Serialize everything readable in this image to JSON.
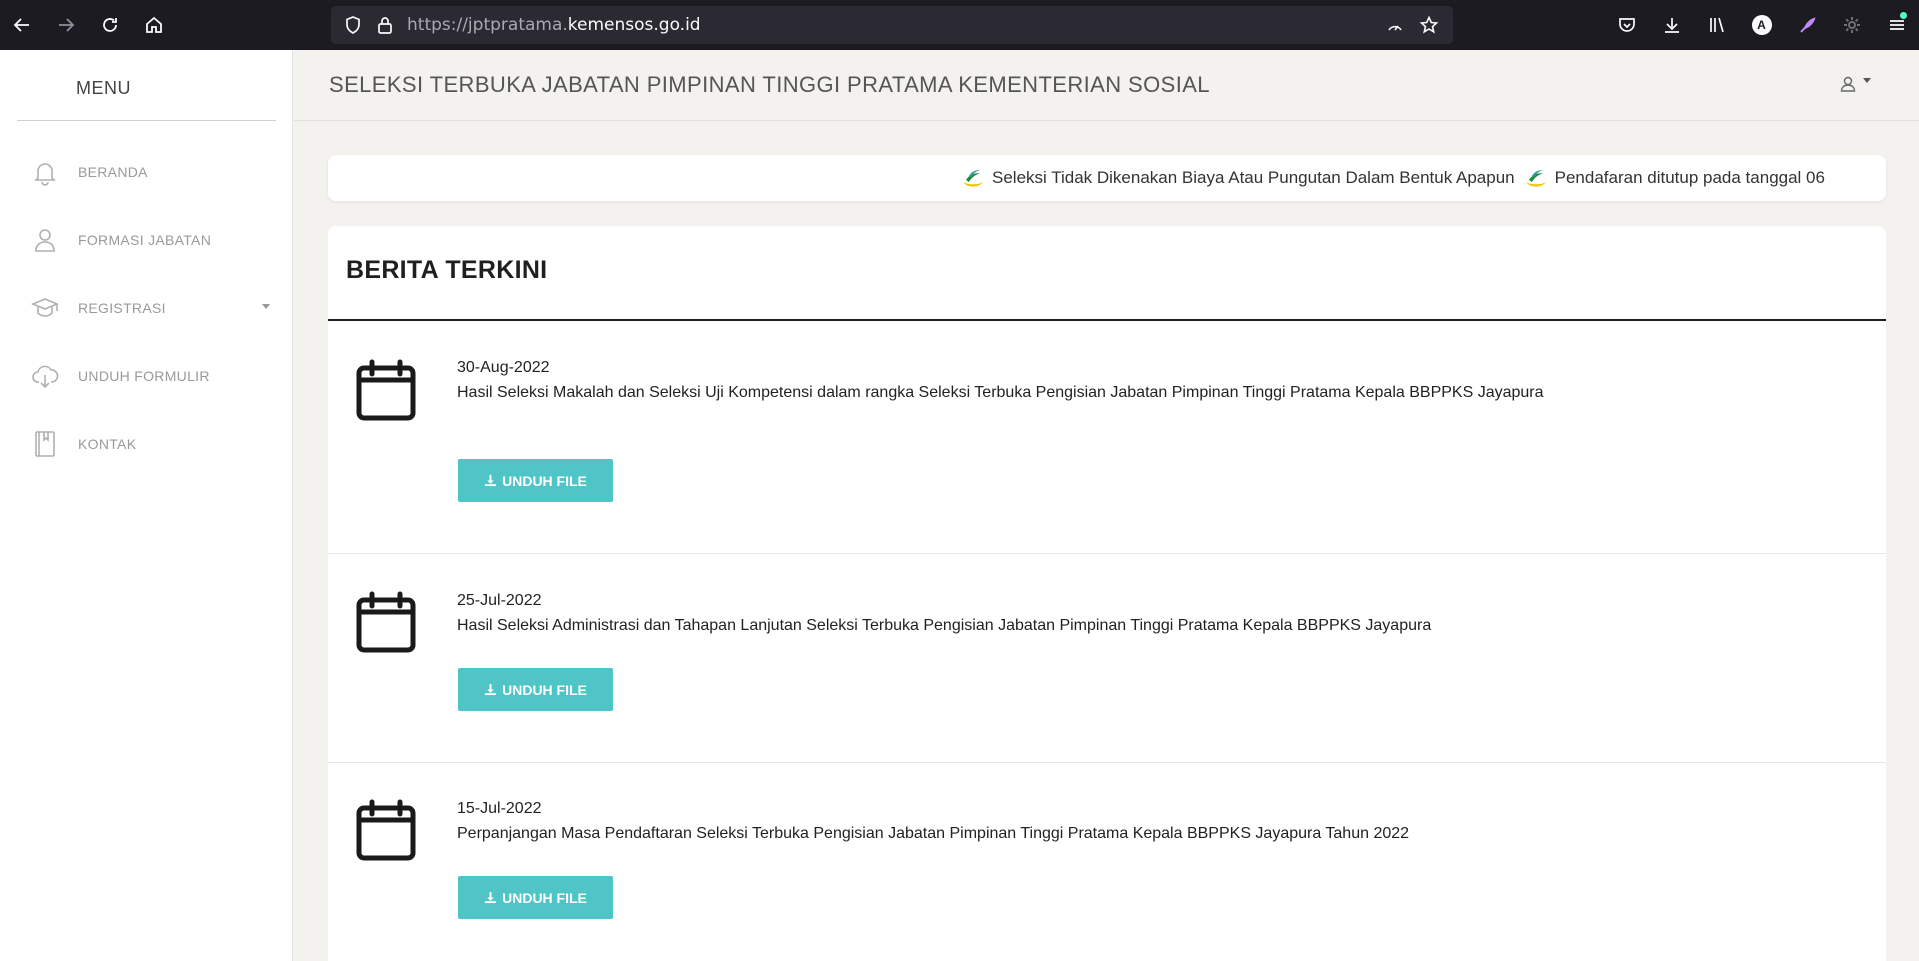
{
  "browser": {
    "url_prefix": "https://jptpratama.",
    "url_host": "kemensos.go.id"
  },
  "sidebar": {
    "menu_title": "MENU",
    "items": [
      {
        "label": "BERANDA",
        "icon": "bell-icon"
      },
      {
        "label": "FORMASI JABATAN",
        "icon": "user-icon"
      },
      {
        "label": "REGISTRASI",
        "icon": "graduation-cap-icon"
      },
      {
        "label": "UNDUH FORMULIR",
        "icon": "cloud-download-icon"
      },
      {
        "label": "KONTAK",
        "icon": "book-icon"
      }
    ]
  },
  "header": {
    "title": "SELEKSI TERBUKA JABATAN PIMPINAN TINGGI PRATAMA KEMENTERIAN SOSIAL"
  },
  "marquee": {
    "messages": [
      "Seleksi Tidak Dikenakan Biaya Atau Pungutan Dalam Bentuk Apapun",
      "Pendafaran ditutup pada tanggal 06"
    ]
  },
  "news": {
    "heading": "BERITA TERKINI",
    "button_label": "UNDUH FILE",
    "items": [
      {
        "date": "30-Aug-2022",
        "text": "Hasil Seleksi Makalah dan Seleksi Uji Kompetensi dalam rangka Seleksi Terbuka Pengisian Jabatan Pimpinan Tinggi Pratama Kepala BBPPKS Jayapura"
      },
      {
        "date": "25-Jul-2022",
        "text": "Hasil Seleksi Administrasi dan Tahapan Lanjutan Seleksi Terbuka Pengisian Jabatan Pimpinan Tinggi Pratama Kepala BBPPKS Jayapura"
      },
      {
        "date": "15-Jul-2022",
        "text": "Perpanjangan Masa Pendaftaran Seleksi Terbuka Pengisian Jabatan Pimpinan Tinggi Pratama Kepala BBPPKS Jayapura Tahun 2022"
      }
    ]
  },
  "colors": {
    "button": "#4fc5c7",
    "browser_chrome": "#1c1b22",
    "page_bg": "#f3f2ef"
  }
}
